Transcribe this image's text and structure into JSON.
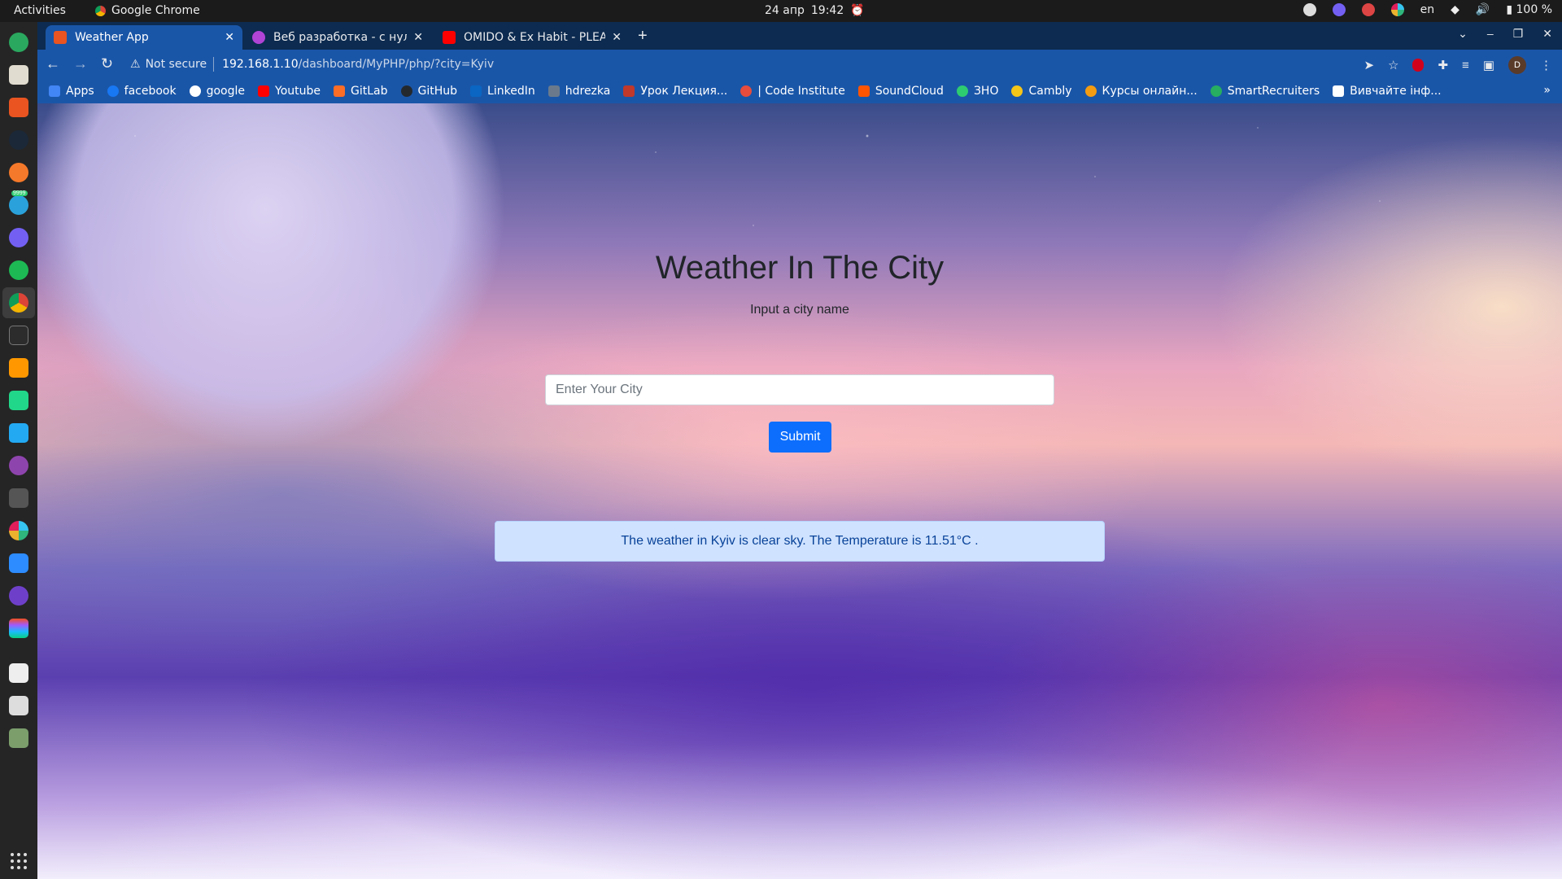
{
  "system": {
    "activities": "Activities",
    "app_name": "Google Chrome",
    "date": "24 апр",
    "time": "19:42",
    "keyboard_layout": "en",
    "battery": "100 %"
  },
  "dock": {
    "items": [
      "telegram-desktop",
      "files",
      "software-center",
      "steam",
      "blender",
      "telegram",
      "viber",
      "spotify",
      "chrome",
      "terminal",
      "sublime-text",
      "pycharm",
      "vscode",
      "podcasts",
      "usb-creator",
      "slack",
      "zoom",
      "github-desktop",
      "figma",
      "text-editor",
      "photo-viewer",
      "trash"
    ],
    "telegram_badge": "9999"
  },
  "tabs": [
    {
      "label": "Weather App",
      "active": true,
      "favicon_color": "#e95420"
    },
    {
      "label": "Веб разработка - с нуля д",
      "active": false,
      "favicon_color": "#b044d6"
    },
    {
      "label": "OMIDO & Ex Habit - PLEA",
      "active": false,
      "favicon_color": "#ff0000"
    }
  ],
  "toolbar": {
    "security_label": "Not secure",
    "url_host": "192.168.1.10",
    "url_path": "/dashboard/MyPHP/php/?city=Kyiv",
    "avatar_letter": "D"
  },
  "bookmarks": [
    {
      "label": "Apps",
      "color": "#4285f4"
    },
    {
      "label": "facebook",
      "color": "#1877f2"
    },
    {
      "label": "google",
      "color": "#ffffff"
    },
    {
      "label": "Youtube",
      "color": "#ff0000"
    },
    {
      "label": "GitLab",
      "color": "#fc6d26"
    },
    {
      "label": "GitHub",
      "color": "#24292e"
    },
    {
      "label": "LinkedIn",
      "color": "#0a66c2"
    },
    {
      "label": "hdrezka",
      "color": "#6a7a8c"
    },
    {
      "label": "Урок Лекция...",
      "color": "#c0392b"
    },
    {
      "label": "| Code Institute",
      "color": "#e74c3c"
    },
    {
      "label": "SoundCloud",
      "color": "#ff5500"
    },
    {
      "label": "ЗНО",
      "color": "#2ecc71"
    },
    {
      "label": "Cambly",
      "color": "#f5c518"
    },
    {
      "label": "Курсы онлайн...",
      "color": "#f39c12"
    },
    {
      "label": "SmartRecruiters",
      "color": "#27ae60"
    },
    {
      "label": "Вивчайте інф...",
      "color": "#ffffff"
    }
  ],
  "page": {
    "title": "Weather In The City",
    "subtitle": "Input a city name",
    "input_placeholder": "Enter Your City",
    "submit_label": "Submit",
    "result_text": "The weather in Kyiv is clear sky. The Temperature is 11.51°C ."
  },
  "colors": {
    "primary_button": "#0d6efd",
    "alert_bg": "#cfe2ff",
    "alert_text": "#084298",
    "chrome_frame": "#1a56a8"
  }
}
